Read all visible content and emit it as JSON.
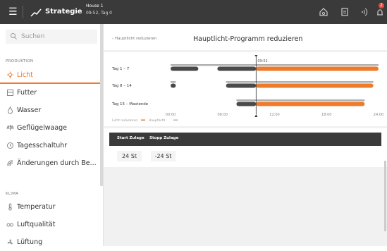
{
  "topbar": {
    "menu_icon": "hamburger-icon",
    "title": "Strategie",
    "house": "House 1",
    "time_day": "09:52, Tag 0",
    "icons": [
      "home-icon",
      "clipboard-icon",
      "wifi-icon",
      "alarm-icon"
    ],
    "alarm_badge": "2"
  },
  "sidebar": {
    "search_placeholder": "Suchen",
    "sections": [
      {
        "title": "PRODUKTION",
        "items": [
          {
            "label": "Licht",
            "icon": "light-icon",
            "active": true
          },
          {
            "label": "Futter",
            "icon": "feed-icon"
          },
          {
            "label": "Wasser",
            "icon": "water-drop-icon"
          },
          {
            "label": "Geflügelwaage",
            "icon": "scale-icon"
          },
          {
            "label": "Tagesschaltuhr",
            "icon": "clock-icon"
          },
          {
            "label": "Änderungen durch Be...",
            "icon": "changes-icon"
          }
        ]
      },
      {
        "title": "KLIMA",
        "items": [
          {
            "label": "Temperatur",
            "icon": "thermometer-icon"
          },
          {
            "label": "Luftqualität",
            "icon": "co2-icon"
          },
          {
            "label": "Lüftung",
            "icon": "fan-icon"
          }
        ]
      }
    ]
  },
  "main": {
    "back_label": "Hauptlicht reduzieren",
    "title": "Hauptlicht-Programm reduzieren",
    "table": {
      "headers": [
        "Start Zulage",
        "Stopp Zulage"
      ],
      "values": [
        "24 St",
        "-24 St"
      ]
    }
  },
  "chart_data": {
    "type": "gantt",
    "now_label": "09:52",
    "now_hour": 9.87,
    "x_ticks": [
      "00:00",
      "06:00",
      "12:00",
      "18:00",
      "24:00"
    ],
    "x_range": [
      0,
      24
    ],
    "legend": [
      {
        "name": "Licht reduzieren",
        "color": "#ee7a2a"
      },
      {
        "name": "Hauptlicht",
        "color": "#b0b0b0"
      }
    ],
    "rows": [
      {
        "label": "Tag 1 – 7",
        "gray_bars": [
          [
            0,
            24
          ]
        ],
        "dark_bars": [
          [
            0,
            3.2
          ],
          [
            5.4,
            9.87
          ]
        ],
        "orange_bars": [
          [
            9.87,
            24
          ]
        ]
      },
      {
        "label": "Tag 8 – 14",
        "gray_bars": [
          [
            0,
            0.6
          ],
          [
            6.4,
            23.4
          ]
        ],
        "dark_bars": [
          [
            0,
            0.6
          ],
          [
            6.4,
            9.87
          ]
        ],
        "orange_bars": [
          [
            9.87,
            23.4
          ]
        ]
      },
      {
        "label": "Tag 15 – Mastende",
        "gray_bars": [
          [
            7.6,
            22.4
          ]
        ],
        "dark_bars": [
          [
            7.6,
            9.87
          ]
        ],
        "orange_bars": [
          [
            9.87,
            22.4
          ]
        ]
      }
    ]
  }
}
